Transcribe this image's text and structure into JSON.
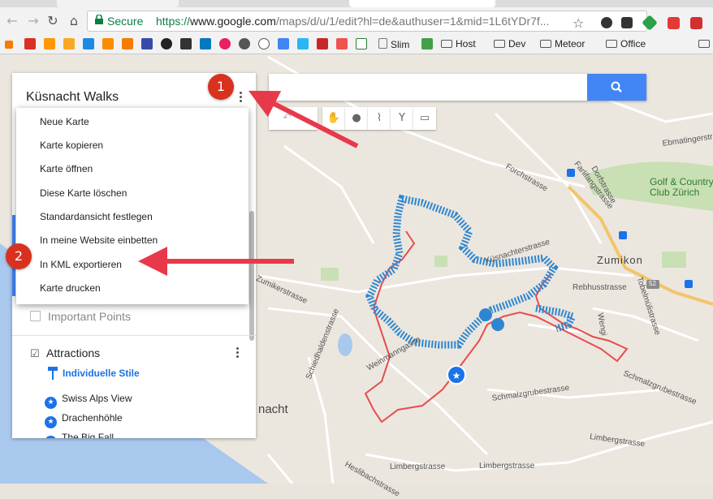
{
  "browser": {
    "secure_label": "Secure",
    "url_scheme": "https://",
    "url_host": "www.google.com",
    "url_path": "/maps/d/u/1/edit?hl=de&authuser=1&mid=1L6tYDr7f...",
    "icons": [
      "back-icon",
      "forward-icon",
      "reload-icon",
      "home-icon",
      "lock-icon",
      "star-icon"
    ],
    "extension_colors": [
      "#333333",
      "#2aa14a",
      "#e53935",
      "#d32f2f"
    ]
  },
  "bookmarks": {
    "slim": "Slim",
    "host": "Host",
    "dev": "Dev",
    "meteor": "Meteor",
    "office": "Office"
  },
  "panel": {
    "map_title": "Küsnacht Walks",
    "hidden_layer": "Important Points",
    "layer": {
      "title": "Attractions",
      "style_link": "Individuelle Stile",
      "places": [
        "Swiss Alps View",
        "Drachenhöhle",
        "The Big Fall"
      ]
    }
  },
  "menu": {
    "items": [
      "Neue Karte",
      "Karte kopieren",
      "Karte öffnen",
      "Diese Karte löschen",
      "Standardansicht festlegen",
      "In meine Website einbetten",
      "In KML exportieren",
      "Karte drucken"
    ]
  },
  "annotations": {
    "step1": "1",
    "step2": "2",
    "color": "#d8321f"
  },
  "map": {
    "labels": {
      "golf": "Golf & Country\nClub Zürich",
      "zumikon": "Zumikon",
      "kuesnacht": "nacht",
      "forchstrasse": "Forchstrasse",
      "kuesnachterstrasse": "Küsnachterstrasse",
      "rebhusstrasse": "Rebhusstrasse",
      "tobelmuelistrasse": "Tobelmülistrasse",
      "schmalzgrubestrasse": "Schmalzgrubestrasse",
      "limbergstrasse": "Limbergstrasse",
      "heslibachstrasse": "Heslibachstrasse",
      "ebmatingerstrasse": "Ebmatingerstr",
      "zumikerstrasse": "Zumikerstrasse",
      "weinmanngasse": "Weinmanngasse",
      "schiedhaldenstrasse": "Schiedhaldenstrasse",
      "wengi": "Wengi",
      "farlifangstrasse": "Farlifangstrasse",
      "dorfstrasse": "Dorfstrasse",
      "road_number": "52"
    },
    "route_colors": {
      "walk": "#2f86d0",
      "trail": "#e84c4c"
    }
  }
}
